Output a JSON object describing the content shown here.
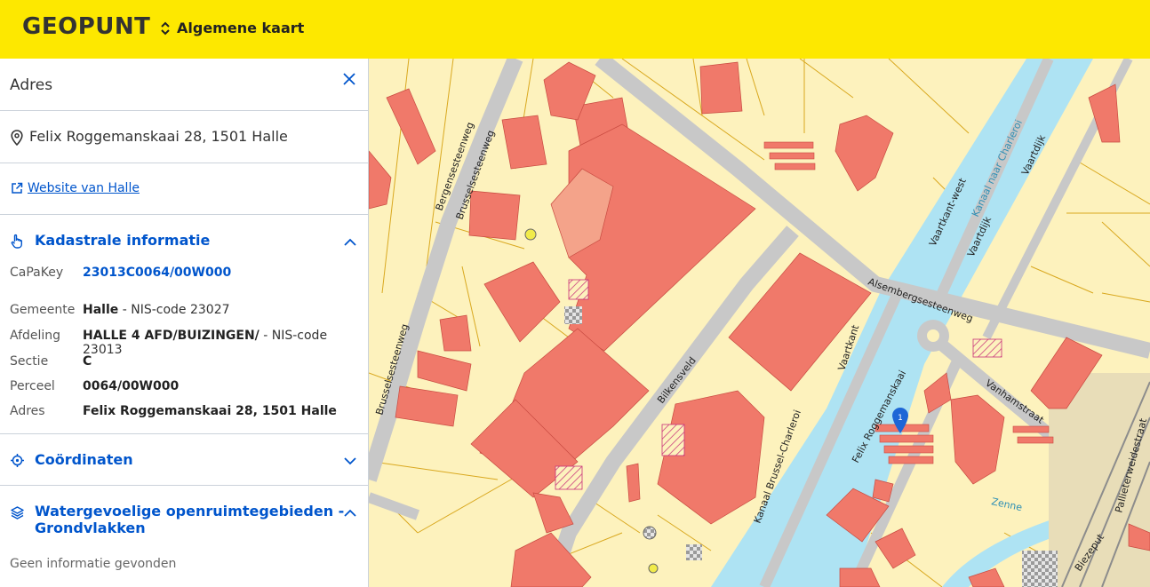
{
  "header": {
    "logo": "GEOPUNT",
    "map_selector_label": "Algemene kaart"
  },
  "panel": {
    "title": "Adres",
    "address": "Felix Roggemanskaai 28, 1501 Halle",
    "website_link": "Website van Halle",
    "kadaster": {
      "title": "Kadastrale informatie",
      "capakey_label": "CaPaKey",
      "capakey_value": "23013C0064/00W000",
      "gemeente_label": "Gemeente",
      "gemeente_name": "Halle",
      "gemeente_code": " - NIS-code 23027",
      "afdeling_label": "Afdeling",
      "afdeling_name": "HALLE 4 AFD/BUIZINGEN/",
      "afdeling_code": " - NIS-code 23013",
      "sectie_label": "Sectie",
      "sectie_value": "C",
      "perceel_label": "Perceel",
      "perceel_value": "0064/00W000",
      "adres_label": "Adres",
      "adres_value": "Felix Roggemanskaai 28, 1501 Halle"
    },
    "coordinaten": {
      "title": "Coördinaten"
    },
    "water": {
      "title_line1": "Watergevoelige openruimtegebieden -",
      "title_line2": "Grondvlakken",
      "empty_text": "Geen informatie gevonden"
    }
  },
  "map": {
    "marker_number": "1",
    "streets": {
      "bergensesteenweg": "Bergensesteenweg",
      "brusselsesteenweg_1": "Brusselsesteenweg",
      "brusselsesteenweg_2": "Brusselsesteenweg",
      "brusselsesteenweg_3": "Brusselsesteenweg",
      "bilkensveld": "Bilkensveld",
      "alsembergsesteenweg": "Alsembergsesteenweg",
      "vaartkant": "Vaartkant",
      "vaartkant_west": "Vaartkant-west",
      "kanaal_naar_charleroi": "Kanaal naar Charleroi",
      "vaartdijk_1": "Vaartdijk",
      "vaartdijk_2": "Vaartdijk",
      "kanaal_brussel_charleroi": "Kanaal Brussel-Charleroi",
      "felix_roggemanskaai": "Felix Roggemanskaai",
      "vanhamstraat": "Vanhamstraat",
      "zenne": "Zenne",
      "biezeput": "Biezeput",
      "pallieterweidestraat": "Pallieterweidestraat"
    },
    "colors": {
      "land": "#FDF2BD",
      "building": "#F0796A",
      "water": "#AEE3F3",
      "road": "#C8C8C8",
      "parcel_line": "#D9A81F",
      "accent": "#FDE800",
      "link": "#0055CC",
      "marker": "#1D66D6"
    }
  }
}
